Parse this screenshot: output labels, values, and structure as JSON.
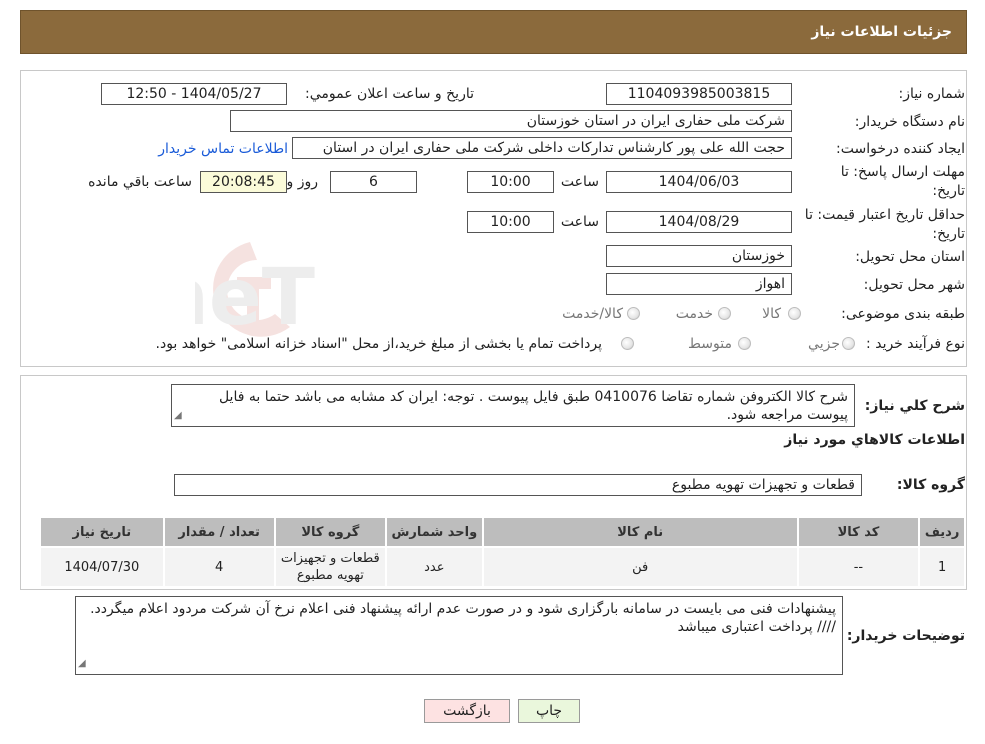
{
  "header": {
    "title": "جزئیات اطلاعات نیاز"
  },
  "watermark": {
    "text": "AriaTender.neT"
  },
  "form": {
    "need_number": {
      "label": "شماره نیاز:",
      "value": "1104093985003815"
    },
    "announce_datetime": {
      "label": "تاریخ و ساعت اعلان عمومي:",
      "value": "1404/05/27 - 12:50"
    },
    "buyer_org": {
      "label": "نام دستگاه خريدار:",
      "value": "شرکت ملی حفاری ایران در استان خوزستان"
    },
    "requester": {
      "label": "ايجاد کننده درخواست:",
      "value": "حجت الله علی پور کارشناس تدارکات داخلی شرکت ملی حفاری ایران در استان",
      "contact_link": "اطلاعات تماس خريدار"
    },
    "deadline": {
      "label_line1": "مهلت ارسال پاسخ: تا",
      "label_line2": "تاريخ:",
      "date": "1404/06/03",
      "time_label": "ساعت",
      "time": "10:00",
      "days": "6",
      "days_label": "روز و",
      "remaining": "20:08:45",
      "remaining_label": "ساعت باقي مانده"
    },
    "price_validity": {
      "label_line1": "حداقل تاريخ اعتبار قيمت: تا",
      "label_line2": "تاريخ:",
      "date": "1404/08/29",
      "time_label": "ساعت",
      "time": "10:00"
    },
    "delivery_province": {
      "label": "استان محل تحويل:",
      "value": "خوزستان"
    },
    "delivery_city": {
      "label": "شهر محل تحويل:",
      "value": "اهواز"
    },
    "category": {
      "label": "طبقه بندی موضوعی:",
      "options": [
        "كالا",
        "خدمت",
        "كالا/خدمت"
      ]
    },
    "purchase_type": {
      "label": "نوع فرآيند خريد :",
      "options": [
        "جزيي",
        "متوسط"
      ],
      "note": "پرداخت تمام يا بخشی از مبلغ خريد،از محل \"اسناد خزانه اسلامی\" خواهد بود."
    }
  },
  "description": {
    "label": "شرح کلي نياز:",
    "text": "شرح کالا الکتروفن شماره تقاضا 0410076 طبق فایل پیوست . توجه: ایران کد مشابه می باشد حتما به فایل پیوست مراجعه شود."
  },
  "goods": {
    "section_title": "اطلاعات کالاهاي مورد نياز",
    "group_label": "گروه کالا:",
    "group_value": "قطعات و تجهیزات تهویه مطبوع",
    "table": {
      "headers": [
        "رديف",
        "کد کالا",
        "نام کالا",
        "واحد شمارش",
        "گروه کالا",
        "تعداد / مقدار",
        "تاريخ نياز"
      ],
      "rows": [
        [
          "1",
          "--",
          "فن",
          "عدد",
          "قطعات و تجهیزات تهویه مطبوع",
          "4",
          "1404/07/30"
        ]
      ]
    }
  },
  "buyer_notes": {
    "label": "توضيحات خريدار:",
    "text": "پیشنهادات فنی می بایست در سامانه بارگزاری شود و در صورت عدم ارائه پیشنهاد فنی اعلام نرخ آن شرکت مردود اعلام میگردد.  //// پرداخت اعتباری میباشد"
  },
  "buttons": {
    "print": "چاپ",
    "back": "بازگشت"
  },
  "colors": {
    "header_bg": "#8b6a3c",
    "yellow_field": "#fbfbd9",
    "print_btn": "#eaf7dc",
    "back_btn": "#fde2e2",
    "link": "#1a5bd8"
  }
}
